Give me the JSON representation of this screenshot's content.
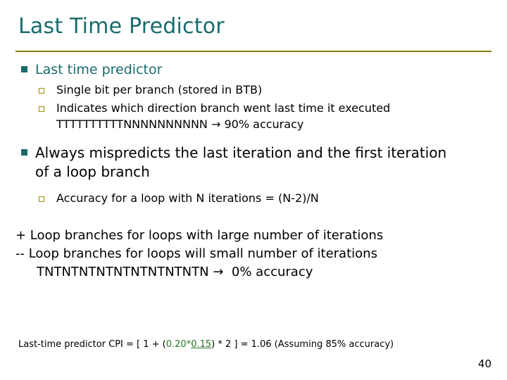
{
  "slide": {
    "title": "Last Time Predictor",
    "page_number": "40",
    "accent_color": "#1a6b6b",
    "rule_color": "#8a7a00",
    "sub_bullet_color": "#9a8c00",
    "footnote_highlight_color": "#267326"
  },
  "content": {
    "item1": {
      "label": "Last time predictor",
      "subs": [
        "Single bit per branch (stored in BTB)",
        "Indicates which direction branch went last time it executed"
      ],
      "sub2_line2": "TTTTTTTTTTNNNNNNNNNN",
      "sub2_arrow": "→",
      "sub2_result": "90% accuracy"
    },
    "item2": {
      "label_line1": "Always mispredicts the last iteration and the first iteration",
      "label_line2": "of a loop branch",
      "subs": [
        "Accuracy for a loop with N iterations = (N-2)/N"
      ]
    },
    "notes": {
      "plus_line": "+ Loop branches for loops with large number of iterations",
      "minus_line": "-- Loop branches for loops will small number of iterations",
      "pattern_line": "TNTNTNTNTNTNTNTNTNTN",
      "pattern_arrow": "→",
      "pattern_result": "0% accuracy"
    },
    "footnote": {
      "prefix": "Last-time predictor CPI = [ 1 + (",
      "green1": "0.20",
      "mid1": "*",
      "green2_underlined": "0.15",
      "mid2": ") * 2 ]  = 1.06  (Assuming 85% accuracy)"
    }
  }
}
